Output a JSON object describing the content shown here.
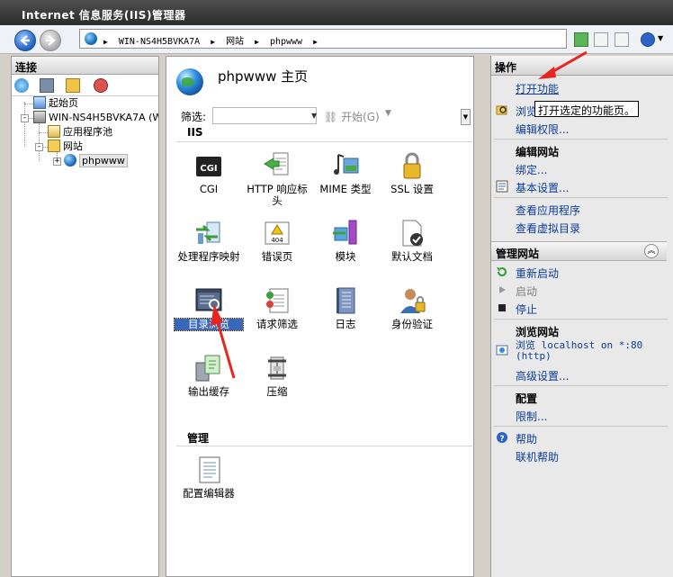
{
  "window": {
    "title": "Internet 信息服务(IIS)管理器"
  },
  "address": {
    "crumbs": [
      "WIN-NS4H5BVKA7A",
      "网站",
      "phpwww"
    ]
  },
  "connections": {
    "header": "连接",
    "tree": [
      {
        "label": "起始页"
      },
      {
        "label": "WIN-NS4H5BVKA7A (WIN"
      },
      {
        "label": "应用程序池"
      },
      {
        "label": "网站"
      },
      {
        "label": "phpwww"
      }
    ]
  },
  "center": {
    "title": "phpwww 主页",
    "filter_label": "筛选:",
    "start_label": "开始(G)",
    "sections": {
      "iis": "IIS",
      "management": "管理"
    },
    "features": [
      {
        "label": "CGI",
        "icon": "cgi-icon"
      },
      {
        "label": "HTTP 响应标头",
        "icon": "http-response-headers-icon"
      },
      {
        "label": "MIME 类型",
        "icon": "mime-types-icon"
      },
      {
        "label": "SSL 设置",
        "icon": "ssl-lock-icon"
      },
      {
        "label": "处理程序映射",
        "icon": "handler-mappings-icon"
      },
      {
        "label": "错误页",
        "icon": "error-pages-icon"
      },
      {
        "label": "模块",
        "icon": "modules-icon"
      },
      {
        "label": "默认文档",
        "icon": "default-document-icon"
      },
      {
        "label": "目录浏览",
        "icon": "directory-browsing-icon"
      },
      {
        "label": "请求筛选",
        "icon": "request-filtering-icon"
      },
      {
        "label": "日志",
        "icon": "logging-icon"
      },
      {
        "label": "身份验证",
        "icon": "authentication-icon"
      },
      {
        "label": "输出缓存",
        "icon": "output-caching-icon"
      },
      {
        "label": "压缩",
        "icon": "compression-icon"
      }
    ],
    "management_features": [
      {
        "label": "配置编辑器",
        "icon": "configuration-editor-icon"
      }
    ]
  },
  "actions": {
    "header": "操作",
    "open_feature": "打开功能",
    "explore": "浏览",
    "edit_permissions": "编辑权限...",
    "edit_site_head": "编辑网站",
    "bindings": "绑定...",
    "basic_settings": "基本设置...",
    "view_app": "查看应用程序",
    "view_vdir": "查看虚拟目录",
    "manage_site_head": "管理网站",
    "restart": "重新启动",
    "start": "启动",
    "stop": "停止",
    "browse_site_head": "浏览网站",
    "browse_line1": "浏览 localhost on *:80",
    "browse_line2": "(http)",
    "advanced_settings": "高级设置...",
    "config_head": "配置",
    "limits": "限制...",
    "help": "帮助",
    "online_help": "联机帮助",
    "tooltip": "打开选定的功能页。"
  },
  "colors": {
    "link": "#0b3d9a",
    "arrow": "#e8261f",
    "selection": "#3b67b8"
  }
}
